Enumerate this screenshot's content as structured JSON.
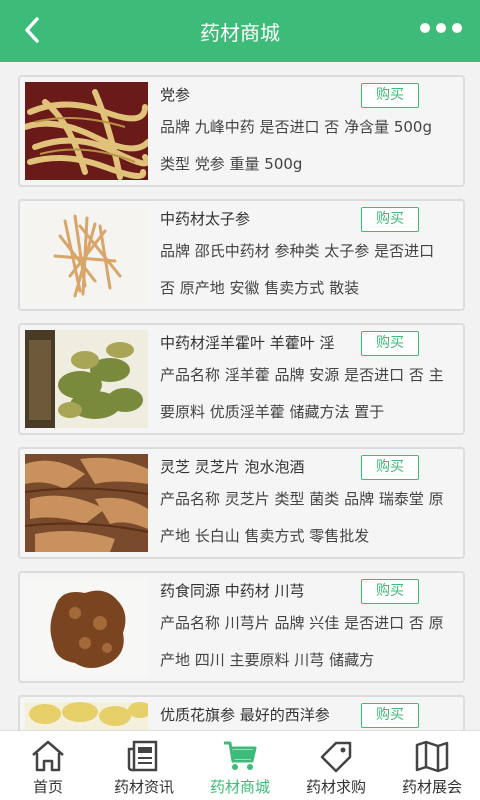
{
  "header": {
    "title": "药材商城"
  },
  "products": [
    {
      "name": "党参",
      "buy": "购买",
      "desc": "品牌 九峰中药 是否进口 否 净含量 500g 类型 党参 重量 500g"
    },
    {
      "name": "中药材太子参",
      "buy": "购买",
      "desc": "品牌 邵氏中药材 参种类 太子参 是否进口 否 原产地 安徽 售卖方式 散装"
    },
    {
      "name": "中药材淫羊霍叶 羊藿叶 淫",
      "buy": "购买",
      "desc": "产品名称 淫羊藿 品牌 安源 是否进口 否 主要原料 优质淫羊藿 储藏方法 置于"
    },
    {
      "name": "灵芝 灵芝片 泡水泡酒",
      "buy": "购买",
      "desc": "产品名称 灵芝片 类型 菌类 品牌 瑞泰堂 原产地 长白山 售卖方式 零售批发"
    },
    {
      "name": "药食同源 中药材 川芎",
      "buy": "购买",
      "desc": "产品名称 川芎片 品牌 兴佳 是否进口 否 原产地 四川 主要原料 川芎 储藏方"
    },
    {
      "name": "优质花旗参 最好的西洋参",
      "buy": "购买",
      "desc": ""
    }
  ],
  "tabs": [
    {
      "label": "首页",
      "icon": "home-icon"
    },
    {
      "label": "药材资讯",
      "icon": "news-icon"
    },
    {
      "label": "药材商城",
      "icon": "cart-icon"
    },
    {
      "label": "药材求购",
      "icon": "tag-icon"
    },
    {
      "label": "药材展会",
      "icon": "map-icon"
    }
  ],
  "colors": {
    "accent": "#3dbb78"
  }
}
